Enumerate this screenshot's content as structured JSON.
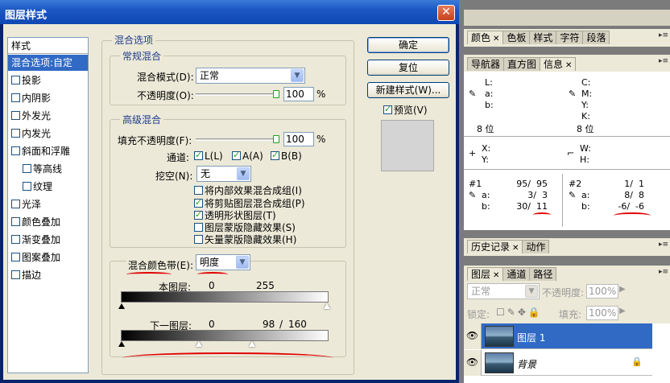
{
  "dialog": {
    "title": "图层样式",
    "close": "✕"
  },
  "styles": {
    "header": "样式",
    "items": [
      {
        "label": "混合选项:自定",
        "selected": true,
        "checkbox": false,
        "indent": false
      },
      {
        "label": "投影",
        "checkbox": true,
        "indent": false
      },
      {
        "label": "内阴影",
        "checkbox": true,
        "indent": false
      },
      {
        "label": "外发光",
        "checkbox": true,
        "indent": false
      },
      {
        "label": "内发光",
        "checkbox": true,
        "indent": false
      },
      {
        "label": "斜面和浮雕",
        "checkbox": true,
        "indent": false
      },
      {
        "label": "等高线",
        "checkbox": true,
        "indent": true
      },
      {
        "label": "纹理",
        "checkbox": true,
        "indent": true
      },
      {
        "label": "光泽",
        "checkbox": true,
        "indent": false
      },
      {
        "label": "颜色叠加",
        "checkbox": true,
        "indent": false
      },
      {
        "label": "渐变叠加",
        "checkbox": true,
        "indent": false
      },
      {
        "label": "图案叠加",
        "checkbox": true,
        "indent": false
      },
      {
        "label": "描边",
        "checkbox": true,
        "indent": false
      }
    ]
  },
  "blend": {
    "group_title": "混合选项",
    "general": {
      "title": "常规混合",
      "mode_label": "混合模式(D):",
      "mode_value": "正常",
      "opacity_label": "不透明度(O):",
      "opacity_value": "100",
      "percent": "%",
      "opacity_level": 1.0
    },
    "advanced": {
      "title": "高级混合",
      "fill_label": "填充不透明度(F):",
      "fill_value": "100",
      "fill_level": 1.0,
      "percent": "%",
      "channels_label": "通道:",
      "ch_l": "L(L)",
      "ch_a": "A(A)",
      "ch_b": "B(B)",
      "knockout_label": "挖空(N):",
      "knockout_value": "无",
      "opt1": "将内部效果混合成组(I)",
      "opt2": "将剪贴图层混合成组(P)",
      "opt3": "透明形状图层(T)",
      "opt4": "图层蒙版隐藏效果(S)",
      "opt5": "矢量蒙版隐藏效果(H)"
    },
    "band": {
      "label": "混合颜色带(E):",
      "value": "明度",
      "this_label": "本图层:",
      "this_lo": "0",
      "this_hi": "255",
      "under_label": "下一图层:",
      "under_lo": "0",
      "under_split": "98",
      "slash": "/",
      "under_hi": "160"
    }
  },
  "buttons": {
    "ok": "确定",
    "reset": "复位",
    "new_style": "新建样式(W)...",
    "preview": "预览(V)"
  },
  "panel1": {
    "tabs": [
      "颜色",
      "色板",
      "样式",
      "字符",
      "段落"
    ]
  },
  "panel2": {
    "tabs": [
      "导航器",
      "直方图",
      "信息"
    ],
    "lab": {
      "l": "L:",
      "a": "a:",
      "b": "b:"
    },
    "cmyk": {
      "c": "C:",
      "m": "M:",
      "y": "Y:",
      "k": "K:"
    },
    "bit_left": "8 位",
    "bit_right": "8 位",
    "x": "X:",
    "y": "Y:",
    "w": "W:",
    "h": "H:",
    "s1": {
      "id": "#1",
      "l": "95/  95",
      "a": "3/  3",
      "b": "30/  11"
    },
    "s2": {
      "id": "#2",
      "l": "1/  1",
      "a": "8/  8",
      "b": "-6/  -6"
    }
  },
  "panel3": {
    "tabs": [
      "历史记录",
      "动作"
    ]
  },
  "panel4": {
    "tabs": [
      "图层",
      "通道",
      "路径"
    ],
    "mode": "正常",
    "opacity_label": "不透明度:",
    "opacity": "100%",
    "lock_label": "锁定:",
    "fill_label": "填充:",
    "fill": "100%",
    "layers": [
      {
        "name": "图层 1",
        "selected": true
      },
      {
        "name": "背景",
        "selected": false
      }
    ]
  }
}
